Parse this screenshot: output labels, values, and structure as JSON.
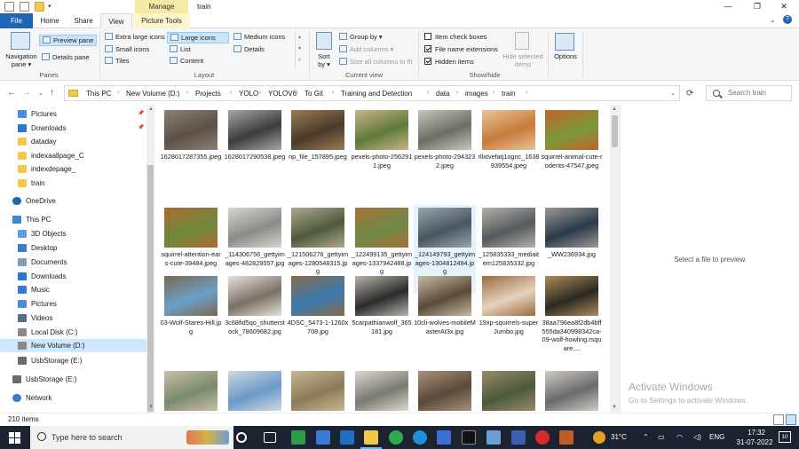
{
  "window": {
    "title": "train",
    "manage_label": "Manage",
    "controls": {
      "minimize": "—",
      "maximize": "❐",
      "close": "✕"
    }
  },
  "ribbon_tabs": {
    "file": "File",
    "home": "Home",
    "share": "Share",
    "view": "View",
    "picture_tools": "Picture Tools"
  },
  "ribbon": {
    "panes": {
      "label": "Panes",
      "navigation_pane": "Navigation",
      "navigation_pane_sub": "pane ▾",
      "preview_pane": "Preview pane",
      "details_pane": "Details pane"
    },
    "layout": {
      "label": "Layout",
      "extra_large_icons": "Extra large icons",
      "large_icons": "Large icons",
      "medium_icons": "Medium icons",
      "small_icons": "Small icons",
      "list": "List",
      "details": "Details",
      "tiles": "Tiles",
      "content": "Content"
    },
    "current_view": {
      "label": "Current view",
      "sort_by": "Sort",
      "sort_by_sub": "by ▾",
      "group_by": "Group by ▾",
      "add_columns": "Add columns ▾",
      "size_all_columns": "Size all columns to fit"
    },
    "show_hide": {
      "label": "Show/hide",
      "item_check_boxes": "Item check boxes",
      "item_check_boxes_checked": false,
      "file_name_extensions": "File name extensions",
      "file_name_extensions_checked": true,
      "hidden_items": "Hidden items",
      "hidden_items_checked": true,
      "hide_selected": "Hide selected",
      "hide_selected_sub": "items"
    },
    "options": {
      "label": "Options"
    }
  },
  "address": {
    "breadcrumbs": [
      "This PC",
      "New Volume (D:)",
      "Projects",
      "YOLO",
      "YOLOV6",
      "To Git",
      "Training and Detection",
      "data",
      "images",
      "train"
    ],
    "search_placeholder": "Search train"
  },
  "nav_pane": {
    "items": [
      {
        "label": "Pictures",
        "icon": "pictures-icon",
        "pinned": true
      },
      {
        "label": "Downloads",
        "icon": "downloads-icon",
        "pinned": true
      },
      {
        "label": "dataday",
        "icon": "folder-icon",
        "pinned": false
      },
      {
        "label": "indexaallpage_C",
        "icon": "folder-icon",
        "pinned": false
      },
      {
        "label": "indexdepage_",
        "icon": "folder-icon",
        "pinned": false
      },
      {
        "label": "train",
        "icon": "folder-icon",
        "pinned": false
      },
      {
        "label": "OneDrive",
        "icon": "onedrive-icon",
        "pinned": false
      },
      {
        "label": "This PC",
        "icon": "pc-icon",
        "pinned": false
      },
      {
        "label": "3D Objects",
        "icon": "3d-objects-icon",
        "pinned": false
      },
      {
        "label": "Desktop",
        "icon": "desktop-icon",
        "pinned": false
      },
      {
        "label": "Documents",
        "icon": "documents-icon",
        "pinned": false
      },
      {
        "label": "Downloads",
        "icon": "downloads-icon",
        "pinned": false
      },
      {
        "label": "Music",
        "icon": "music-icon",
        "pinned": false
      },
      {
        "label": "Pictures",
        "icon": "pictures-icon",
        "pinned": false
      },
      {
        "label": "Videos",
        "icon": "videos-icon",
        "pinned": false
      },
      {
        "label": "Local Disk (C:)",
        "icon": "drive-icon",
        "pinned": false
      },
      {
        "label": "New Volume (D:)",
        "icon": "drive-icon",
        "pinned": false,
        "selected": true
      },
      {
        "label": "UsbStorage (E:)",
        "icon": "usb-drive-icon",
        "pinned": false
      },
      {
        "label": "UsbStorage (E:)",
        "icon": "usb-drive-icon",
        "pinned": false
      },
      {
        "label": "Network",
        "icon": "network-icon",
        "pinned": false
      }
    ]
  },
  "files": [
    {
      "name": "1628017287355.jpeg",
      "colors": [
        "#5b5148",
        "#8c8070"
      ]
    },
    {
      "name": "1628017290538.jpeg",
      "colors": [
        "#3e3b3c",
        "#a7a5a6"
      ]
    },
    {
      "name": "np_file_157895.jpeg",
      "colors": [
        "#4a3a2a",
        "#9b7b54"
      ]
    },
    {
      "name": "pexels-photo-2562911.jpeg",
      "colors": [
        "#5f7a3a",
        "#c9b48a"
      ]
    },
    {
      "name": "pexels-photo-2943232.jpeg",
      "colors": [
        "#6b6f63",
        "#c7c4bc"
      ]
    },
    {
      "name": "rllxtvefatj1ognc_1638939554.jpeg",
      "colors": [
        "#c77a3a",
        "#e8c59a"
      ]
    },
    {
      "name": "squirrel-animal-cute-rodents-47547.jpeg",
      "colors": [
        "#7a9a3a",
        "#c4622a"
      ]
    },
    {
      "name": "squirrel-attention-ears-cute-39484.jpeg",
      "colors": [
        "#6c8a3c",
        "#b06a33"
      ]
    },
    {
      "name": "_114306756_gettyimages-482829557.jpg",
      "colors": [
        "#8b8b88",
        "#d8d6d0"
      ]
    },
    {
      "name": "_121506276_gettyimages-1280548315.jpg",
      "colors": [
        "#4f5a3a",
        "#b0a890"
      ]
    },
    {
      "name": "_122499135_gettyimages-1337942488.jpg",
      "colors": [
        "#6f8a48",
        "#a8703a"
      ]
    },
    {
      "name": "_124149793_gettyimages-1304812494.jpg",
      "colors": [
        "#4a5560",
        "#9aa6ae"
      ],
      "selected": true
    },
    {
      "name": "_125835333_mediaitem125835332.jpg",
      "colors": [
        "#555a5e",
        "#b4b0a8"
      ]
    },
    {
      "name": "_WW236934.jpg",
      "colors": [
        "#2a3a4a",
        "#9a9a94"
      ]
    },
    {
      "name": "03-Wolf-Stares-Hill.jpg",
      "colors": [
        "#6aa0c8",
        "#7a6a50"
      ]
    },
    {
      "name": "3c68fid5qo_shutterstock_78609682.jpg",
      "colors": [
        "#7a7066",
        "#e6e2dc"
      ]
    },
    {
      "name": "4DSC_5473-1-1260x708.jpg",
      "colors": [
        "#3a7ab0",
        "#8a6a48"
      ]
    },
    {
      "name": "5carpathianwolf_365181.jpg",
      "colors": [
        "#2a2a2a",
        "#b8b4ac"
      ]
    },
    {
      "name": "10cli-wolves-mobileMasterAt3x.jpg",
      "colors": [
        "#5a4a3a",
        "#c8b8a0"
      ]
    },
    {
      "name": "19xp-squirrels-superJumbo.jpg",
      "colors": [
        "#e6d2bc",
        "#9a6a40"
      ]
    },
    {
      "name": "38aa796ea8f2db4bff555da340998342ca-09-wolf-howling.rsquare....",
      "colors": [
        "#2a2a22",
        "#b08a5a"
      ]
    },
    {
      "name": "",
      "colors": [
        "#7a8a6a",
        "#c8c0a8"
      ]
    },
    {
      "name": "",
      "colors": [
        "#6a9ac8",
        "#d0d8e0"
      ]
    },
    {
      "name": "",
      "colors": [
        "#8a7a5a",
        "#c8b890"
      ]
    },
    {
      "name": "",
      "colors": [
        "#7a7a72",
        "#dcd8cc"
      ]
    },
    {
      "name": "",
      "colors": [
        "#5a4a3a",
        "#a89078"
      ]
    },
    {
      "name": "",
      "colors": [
        "#4a5a3a",
        "#9a8a6a"
      ]
    },
    {
      "name": "",
      "colors": [
        "#6a6a6a",
        "#d0ccc6"
      ]
    }
  ],
  "preview": {
    "empty_text": "Select a file to preview.",
    "activate_title": "Activate Windows",
    "activate_sub": "Go to Settings to activate Windows."
  },
  "status": {
    "item_count": "210 items"
  },
  "taskbar": {
    "search_text": "Type here to search",
    "temperature": "31°C",
    "language": "ENG",
    "time": "17:32",
    "date": "31-07-2022",
    "notification_count": "10"
  },
  "colors": {
    "accent": "#1f67b4",
    "selection": "#cde8ff",
    "taskbar": "#1b2330"
  }
}
